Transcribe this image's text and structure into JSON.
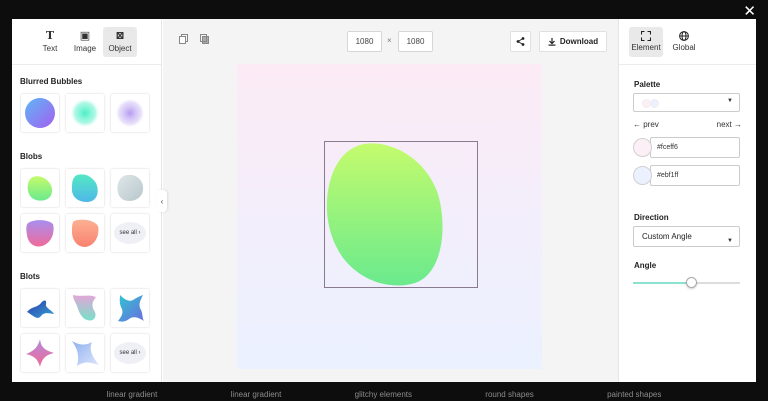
{
  "close_label": "✕",
  "background_tabs": [
    "linear gradient",
    "linear gradient",
    "glitchy elements",
    "round shapes",
    "painted shapes"
  ],
  "left_panel": {
    "tools": [
      {
        "label": "Text",
        "icon": "text-tool-icon",
        "glyph": "T"
      },
      {
        "label": "Image",
        "icon": "image-tool-icon",
        "glyph": "▣"
      },
      {
        "label": "Object",
        "icon": "object-tool-icon",
        "glyph": "⊠"
      }
    ],
    "sections": {
      "blurred_bubbles": "Blurred Bubbles",
      "blobs": "Blobs",
      "blots": "Blots"
    },
    "see_all": "see all ›",
    "collapse_glyph": "‹"
  },
  "center": {
    "width_value": "1080",
    "height_value": "1080",
    "times": "×",
    "download_label": "Download",
    "canvas_top_color": "#fcebf5",
    "canvas_bottom_color": "#ebf1ff",
    "blob_top_color": "#c4fb6d",
    "blob_bottom_color": "#6aea8d"
  },
  "right_panel": {
    "tabs": [
      {
        "label": "Element",
        "icon": "expand-icon"
      },
      {
        "label": "Global",
        "icon": "globe-icon"
      }
    ],
    "palette_label": "Palette",
    "palette_colors": [
      "#fceff6",
      "#ebf1ff"
    ],
    "prev_label": "← prev",
    "next_label": "next →",
    "color_1": "#fceff6",
    "color_2": "#ebf1ff",
    "direction_label": "Direction",
    "direction_value": "Custom Angle",
    "angle_label": "Angle",
    "angle_fraction": 0.55,
    "accent_color": "#8be3cf"
  }
}
